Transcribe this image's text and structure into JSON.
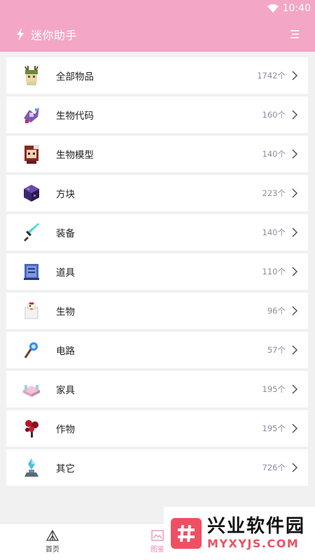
{
  "status_bar": {
    "time": "10:40"
  },
  "app_bar": {
    "title": "迷你助手",
    "menu_icon": "menu-lines-icon"
  },
  "list": [
    {
      "label": "全部物品",
      "count": "1742个",
      "icon": "antler-girl-avatar"
    },
    {
      "label": "生物代码",
      "count": "160个",
      "icon": "dragon-creature"
    },
    {
      "label": "生物模型",
      "count": "140个",
      "icon": "red-hair-girl"
    },
    {
      "label": "方块",
      "count": "223个",
      "icon": "purple-block"
    },
    {
      "label": "装备",
      "count": "140个",
      "icon": "diamond-sword"
    },
    {
      "label": "道具",
      "count": "110个",
      "icon": "blue-scroll"
    },
    {
      "label": "生物",
      "count": "96个",
      "icon": "chicken"
    },
    {
      "label": "电路",
      "count": "57个",
      "icon": "blue-torch"
    },
    {
      "label": "家具",
      "count": "195个",
      "icon": "pink-bed"
    },
    {
      "label": "作物",
      "count": "195个",
      "icon": "red-plant"
    },
    {
      "label": "其它",
      "count": "726个",
      "icon": "crystal-statue"
    }
  ],
  "bottom_nav": [
    {
      "label": "首页",
      "icon": "tent-icon",
      "active": false
    },
    {
      "label": "图鉴",
      "icon": "picture-icon",
      "active": true
    }
  ],
  "watermark": {
    "title": "兴业软件园",
    "url": "MYXYJS.COM"
  },
  "colors": {
    "accent": "#f4a6c6",
    "count_text": "#8a8fa0",
    "active_tab": "#f08ab8",
    "watermark_red": "#f04f62"
  }
}
